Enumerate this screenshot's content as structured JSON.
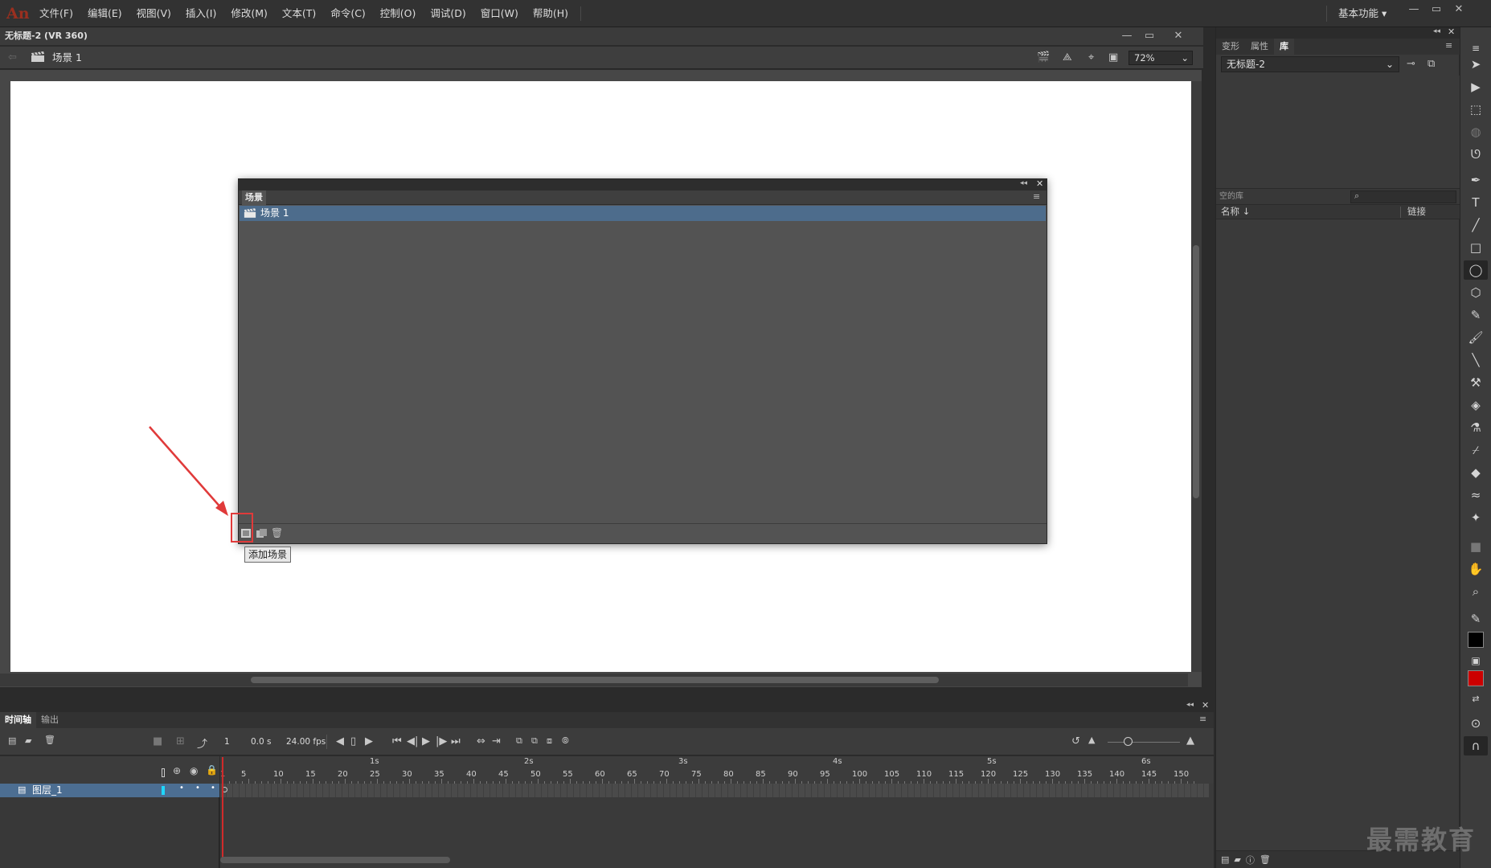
{
  "app": {
    "logo": "An",
    "menu": [
      "文件(F)",
      "编辑(E)",
      "视图(V)",
      "插入(I)",
      "修改(M)",
      "文本(T)",
      "命令(C)",
      "控制(O)",
      "调试(D)",
      "窗口(W)",
      "帮助(H)"
    ],
    "workspace": "基本功能"
  },
  "document": {
    "title": "无标题-2 (VR 360)",
    "scene": "场景 1",
    "zoom": "72%"
  },
  "scene_panel": {
    "tab": "场景",
    "scenes": [
      "场景 1"
    ],
    "tooltip": "添加场景"
  },
  "right_panel": {
    "tabs": [
      "变形",
      "属性",
      "库"
    ],
    "active_tab": "库",
    "library_doc": "无标题-2",
    "library_count": "空的库",
    "columns": {
      "name": "名称 ↓",
      "linkage": "链接"
    }
  },
  "timeline": {
    "tabs": [
      "时间轴",
      "输出"
    ],
    "active_tab": "时间轴",
    "current_frame": "1",
    "time": "0.0 s",
    "fps": "24.00 fps",
    "seconds": [
      "1s",
      "2s",
      "3s",
      "4s",
      "5s",
      "6s"
    ],
    "frame_numbers": [
      "1",
      "5",
      "10",
      "15",
      "20",
      "25",
      "30",
      "35",
      "40",
      "45",
      "50",
      "55",
      "60",
      "65",
      "70",
      "75",
      "80",
      "85",
      "90",
      "95",
      "100",
      "105",
      "110",
      "115",
      "120",
      "125",
      "130",
      "135",
      "140",
      "145",
      "150"
    ],
    "layer": "图层_1"
  },
  "watermark": "最需教育",
  "colors": {
    "accent_red": "#e03a3a",
    "selection_blue": "#4d6c8c",
    "stroke_color": "#000000",
    "fill_color": "#cc0000"
  }
}
